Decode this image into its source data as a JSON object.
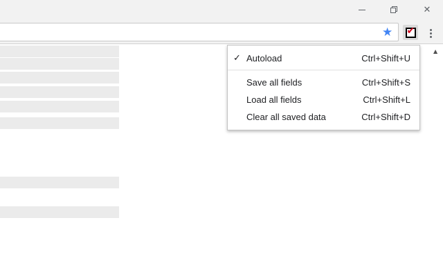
{
  "window_controls": {
    "minimize": "minimize-icon",
    "maximize": "restore-icon",
    "close": "close-icon",
    "close_glyph": "✕"
  },
  "toolbar": {
    "bookmark_icon": "star-icon",
    "bookmark_glyph": "★",
    "bookmark_color": "#4285f4",
    "extension_icon": "form-saver-extension-icon",
    "extension_check_glyph": "✔",
    "extension_check_color": "#d0021b",
    "menu_icon": "more-vert-icon"
  },
  "context_menu": {
    "autoload": {
      "check": "✓",
      "label": "Autoload",
      "shortcut": "Ctrl+Shift+U"
    },
    "items": [
      {
        "label": "Save all fields",
        "shortcut": "Ctrl+Shift+S"
      },
      {
        "label": "Load all fields",
        "shortcut": "Ctrl+Shift+L"
      },
      {
        "label": "Clear all saved data",
        "shortcut": "Ctrl+Shift+D"
      }
    ]
  },
  "scrollbar": {
    "up_glyph": "▲"
  }
}
